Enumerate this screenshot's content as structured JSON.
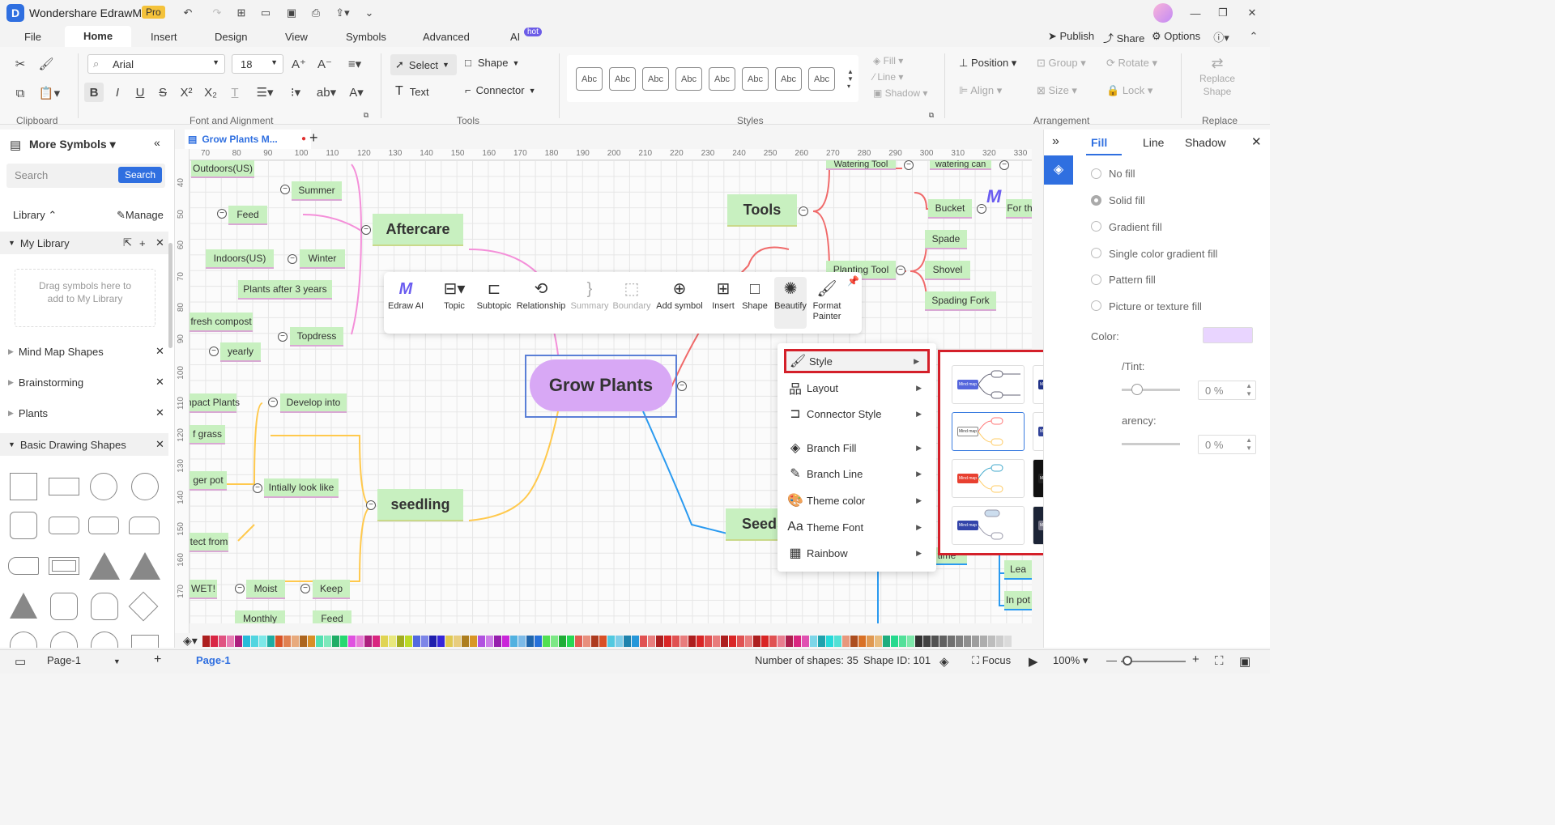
{
  "app": {
    "title": "Wondershare EdrawMax",
    "badge": "Pro"
  },
  "menu": {
    "tabs": [
      "File",
      "Home",
      "Insert",
      "Design",
      "View",
      "Symbols",
      "Advanced",
      "AI"
    ],
    "ai_badge": "hot",
    "publish": "Publish",
    "share": "Share",
    "options": "Options"
  },
  "ribbon": {
    "font_name": "Arial",
    "font_size": "18",
    "select": "Select",
    "shape": "Shape",
    "text": "Text",
    "connector": "Connector",
    "style_samples": [
      "Abc",
      "Abc",
      "Abc",
      "Abc",
      "Abc",
      "Abc",
      "Abc",
      "Abc"
    ],
    "fill": "Fill",
    "line": "Line",
    "shadow": "Shadow",
    "position": "Position",
    "group": "Group",
    "rotate": "Rotate",
    "align": "Align",
    "size": "Size",
    "lock": "Lock",
    "replace_shape": "Replace Shape",
    "groups": {
      "clipboard": "Clipboard",
      "font": "Font and Alignment",
      "tools": "Tools",
      "styles": "Styles",
      "arrangement": "Arrangement",
      "replace": "Replace"
    }
  },
  "left": {
    "title": "More Symbols",
    "search_placeholder": "Search",
    "search_button": "Search",
    "library": "Library",
    "manage": "Manage",
    "my_library": "My Library",
    "drag_hint": "Drag symbols here to add to My Library",
    "libraries": [
      "Mind Map Shapes",
      "Brainstorming",
      "Plants",
      "Basic Drawing Shapes"
    ]
  },
  "doc_tab": {
    "title": "Grow Plants M..."
  },
  "ruler": {
    "h": [
      "70",
      "80",
      "90",
      "100",
      "110",
      "120",
      "130",
      "140",
      "150",
      "160",
      "170",
      "180",
      "190",
      "200",
      "210",
      "220",
      "230",
      "240",
      "250",
      "260",
      "270",
      "280",
      "290",
      "300",
      "310",
      "320",
      "330"
    ],
    "v": [
      "40",
      "50",
      "60",
      "70",
      "80",
      "90",
      "100",
      "110",
      "120",
      "130",
      "140",
      "150",
      "160",
      "170"
    ]
  },
  "mindmap": {
    "central": "Grow Plants",
    "aftercare": "Aftercare",
    "seedling": "seedling",
    "tools": "Tools",
    "seeds": "Seeds",
    "nodes": {
      "outdoors": "Outdoors(US)",
      "summer": "Summer",
      "feed": "Feed",
      "indoors": "Indoors(US)",
      "winter": "Winter",
      "plants_after": "Plants after 3 years",
      "fresh_compost": "fresh compost",
      "topdress": "Topdress",
      "yearly": "yearly",
      "compact_plants": "npact Plants",
      "develop": "Develop into",
      "grass": "f grass",
      "ger_pot": "ger pot",
      "initially": "Intially look like",
      "protect": "tect from",
      "wet": "WET!",
      "moist": "Moist",
      "keep": "Keep",
      "monthly": "Monthly",
      "feed2": "Feed",
      "watering_tool": "Watering Tool",
      "watering_can": "watering can",
      "bucket": "Bucket",
      "for_th": "For th",
      "planting_tool": "Planting Tool",
      "spade": "Spade",
      "shovel": "Shovel",
      "spading_fork": "Spading Fork",
      "in_pot": "In pot",
      "lea": "Lea",
      "time": "h time"
    }
  },
  "floatbar": {
    "items": [
      "Edraw AI",
      "Topic",
      "Subtopic",
      "Relationship",
      "Summary",
      "Boundary",
      "Add symbol",
      "Insert",
      "Shape",
      "Beautify",
      "Format Painter"
    ]
  },
  "context_menu": {
    "items": [
      "Style",
      "Layout",
      "Connector Style",
      "Branch Fill",
      "Branch Line",
      "Theme color",
      "Theme Font",
      "Rainbow"
    ]
  },
  "style_thumbs": [
    "Mind map",
    "Mind map",
    "Mind map",
    "Mind map",
    "Mind map",
    "Mind map",
    "Mind map",
    "Mind map"
  ],
  "right": {
    "tabs": [
      "Fill",
      "Line",
      "Shadow"
    ],
    "fill_options": [
      "No fill",
      "Solid fill",
      "Gradient fill",
      "Single color gradient fill",
      "Pattern fill",
      "Picture or texture fill"
    ],
    "color_label": "Color:",
    "tint_label": "/Tint:",
    "transparency_label": "arency:",
    "tint_value": "0 %",
    "transparency_value": "0 %",
    "accent": "#2f6fe0",
    "color_swatch": "#e9d5ff"
  },
  "status": {
    "page_select": "Page-1",
    "page_tab": "Page-1",
    "shapes": "Number of shapes: 35",
    "shape_id": "Shape ID: 101",
    "focus": "Focus",
    "zoom": "100%"
  }
}
